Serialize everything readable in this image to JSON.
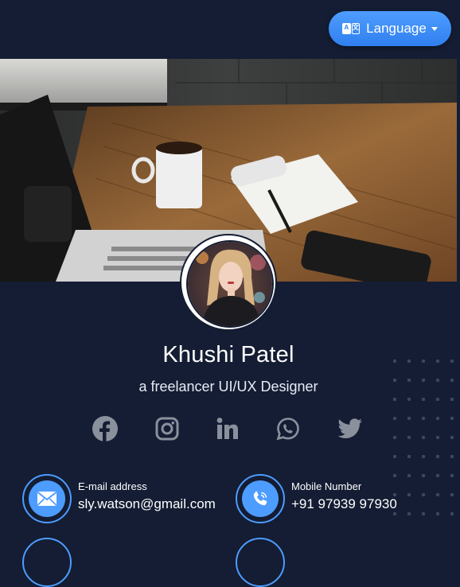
{
  "header": {
    "language_label": "Language"
  },
  "profile": {
    "name": "Khushi Patel",
    "tagline": "a freelancer UI/UX Designer"
  },
  "socials": [
    {
      "icon": "facebook-icon"
    },
    {
      "icon": "instagram-icon"
    },
    {
      "icon": "linkedin-icon"
    },
    {
      "icon": "whatsapp-icon"
    },
    {
      "icon": "twitter-icon"
    }
  ],
  "contacts": {
    "email": {
      "label": "E-mail address",
      "value": "sly.watson@gmail.com"
    },
    "mobile": {
      "label": "Mobile Number",
      "value": "+91 97939 97930"
    }
  },
  "colors": {
    "background": "#141d33",
    "accent": "#4d9cff",
    "social_icon": "#8a909c"
  }
}
